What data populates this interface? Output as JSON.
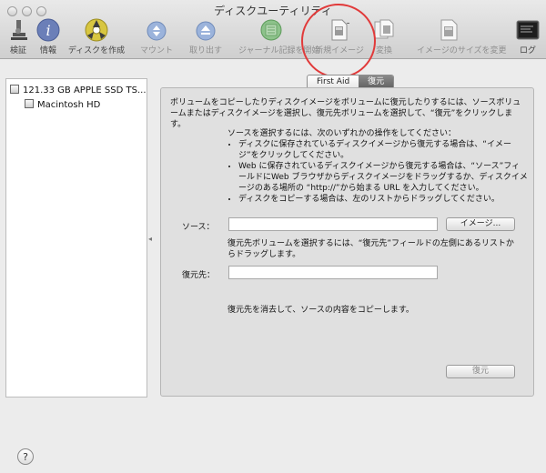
{
  "window": {
    "title": "ディスクユーティリティ"
  },
  "toolbar": {
    "items": [
      {
        "label": "検証",
        "icon": "microscope-icon"
      },
      {
        "label": "情報",
        "icon": "info-icon"
      },
      {
        "label": "ディスクを作成",
        "icon": "burn-icon"
      },
      {
        "label": "マウント",
        "icon": "mount-icon"
      },
      {
        "label": "取り出す",
        "icon": "eject-icon"
      },
      {
        "label": "ジャーナル記録を開始",
        "icon": "journal-icon"
      },
      {
        "label": "新規イメージ",
        "icon": "new-image-icon"
      },
      {
        "label": "変換",
        "icon": "convert-icon"
      },
      {
        "label": "イメージのサイズを変更",
        "icon": "resize-image-icon"
      },
      {
        "label": "ログ",
        "icon": "log-icon"
      }
    ]
  },
  "sidebar": {
    "drive": "121.33 GB APPLE SSD TS...",
    "volume": "Macintosh HD"
  },
  "tabs": [
    {
      "label": "First Aid"
    },
    {
      "label": "復元"
    }
  ],
  "restore": {
    "intro": "ボリュームをコピーしたりディスクイメージをボリュームに復元したりするには、ソースボリュームまたはディスクイメージを選択し、復元先ボリュームを選択して、“復元”をクリックします。",
    "instructions_heading": "ソースを選択するには、次のいずれかの操作をしてください：",
    "instructions": [
      "ディスクに保存されているディスクイメージから復元する場合は、“イメージ”をクリックしてください。",
      "Web に保存されているディスクイメージから復元する場合は、“ソース”フィールドにWeb ブラウザからディスクイメージをドラッグするか、ディスクイメージのある場所の “http://”から始まる URL を入力してください。",
      "ディスクをコピーする場合は、左のリストからドラッグしてください。"
    ],
    "source_label": "ソース：",
    "image_button": "イメージ...",
    "destination_hint": "復元先ボリュームを選択するには、“復元先”フィールドの左側にあるリストからドラッグします。",
    "destination_label": "復元先：",
    "erase_note": "復元先を消去して、ソースの内容をコピーします。",
    "restore_button": "復元"
  },
  "help": {
    "label": "?"
  },
  "colors": {
    "highlight": "#e13a3a"
  }
}
